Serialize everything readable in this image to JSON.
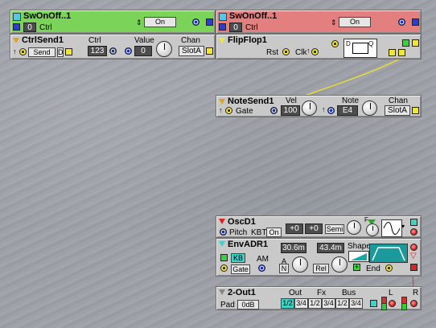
{
  "modules": {
    "swonoff1": {
      "title": "SwOnOff..1",
      "ctrl_value": "0",
      "ctrl_label": "Ctrl",
      "button": "On"
    },
    "swonoff2": {
      "title": "SwOnOff..1",
      "ctrl_value": "0",
      "ctrl_label": "Ctrl",
      "button": "On"
    },
    "ctrlsend": {
      "title": "CtrlSend1",
      "ctrl_label": "Ctrl",
      "ctrl_value": "123",
      "value_label": "Value",
      "value_value": "0",
      "chan_label": "Chan",
      "chan_value": "SlotA",
      "send_label": "Send",
      "d_label": "D"
    },
    "flipflop": {
      "title": "FlipFlop1",
      "rst_label": "Rst",
      "clk_label": "Clk",
      "d_label": "D",
      "q_label": "Q"
    },
    "notesend": {
      "title": "NoteSend1",
      "vel_label": "Vel",
      "vel_value": "100",
      "note_label": "Note",
      "note_value": "E4",
      "chan_label": "Chan",
      "chan_value": "SlotA",
      "gate_label": "Gate"
    },
    "osc": {
      "title": "OscD1",
      "pitch_label": "Pitch",
      "kbt_label": "KBT",
      "kbt_button": "On",
      "coarse": "+0",
      "fine": "+0",
      "semi": "Semi",
      "f_label": "F"
    },
    "envadr": {
      "title": "EnvADR1",
      "attack": "30.6m",
      "decay": "43.4m",
      "shape_label": "Shape",
      "kb": "KB",
      "am_label": "AM",
      "a_label": "A",
      "n_label": "N",
      "gate": "Gate",
      "rel": "Rel",
      "end": "End"
    },
    "out": {
      "title": "2-Out1",
      "out_label": "Out",
      "fx_label": "Fx",
      "bus_label": "Bus",
      "pad_label": "Pad",
      "pad_value": "0dB",
      "opt1": "1/2",
      "opt2": "3/4",
      "l_label": "L",
      "r_label": "R"
    }
  }
}
